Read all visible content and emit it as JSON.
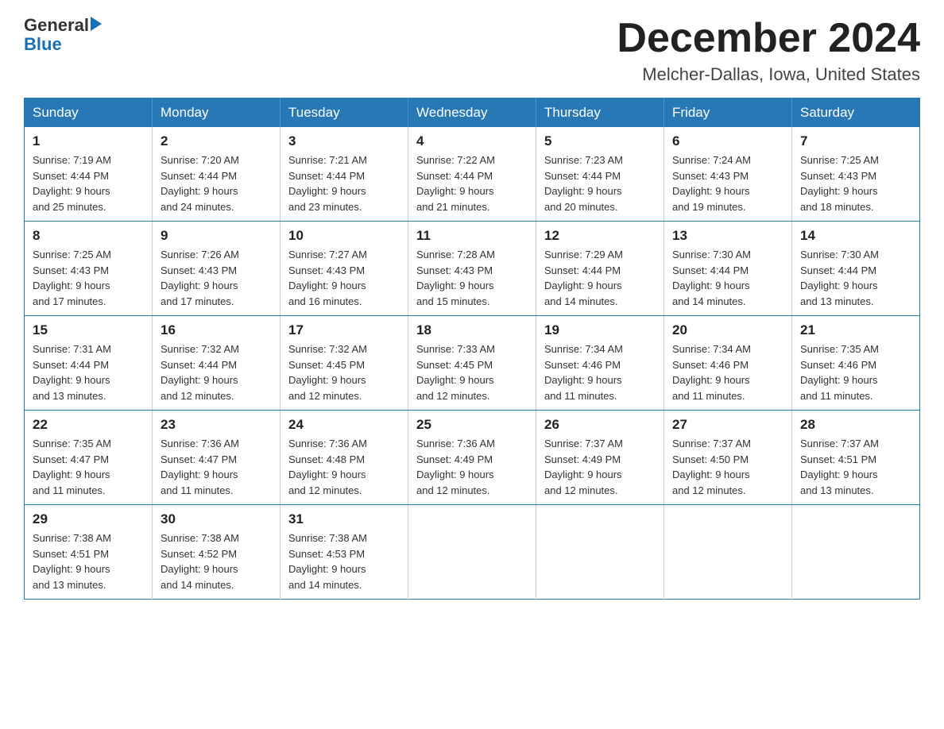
{
  "header": {
    "logo_general": "General",
    "logo_blue": "Blue",
    "month_title": "December 2024",
    "location": "Melcher-Dallas, Iowa, United States"
  },
  "weekdays": [
    "Sunday",
    "Monday",
    "Tuesday",
    "Wednesday",
    "Thursday",
    "Friday",
    "Saturday"
  ],
  "weeks": [
    [
      {
        "day": "1",
        "sunrise": "7:19 AM",
        "sunset": "4:44 PM",
        "daylight": "9 hours and 25 minutes."
      },
      {
        "day": "2",
        "sunrise": "7:20 AM",
        "sunset": "4:44 PM",
        "daylight": "9 hours and 24 minutes."
      },
      {
        "day": "3",
        "sunrise": "7:21 AM",
        "sunset": "4:44 PM",
        "daylight": "9 hours and 23 minutes."
      },
      {
        "day": "4",
        "sunrise": "7:22 AM",
        "sunset": "4:44 PM",
        "daylight": "9 hours and 21 minutes."
      },
      {
        "day": "5",
        "sunrise": "7:23 AM",
        "sunset": "4:44 PM",
        "daylight": "9 hours and 20 minutes."
      },
      {
        "day": "6",
        "sunrise": "7:24 AM",
        "sunset": "4:43 PM",
        "daylight": "9 hours and 19 minutes."
      },
      {
        "day": "7",
        "sunrise": "7:25 AM",
        "sunset": "4:43 PM",
        "daylight": "9 hours and 18 minutes."
      }
    ],
    [
      {
        "day": "8",
        "sunrise": "7:25 AM",
        "sunset": "4:43 PM",
        "daylight": "9 hours and 17 minutes."
      },
      {
        "day": "9",
        "sunrise": "7:26 AM",
        "sunset": "4:43 PM",
        "daylight": "9 hours and 17 minutes."
      },
      {
        "day": "10",
        "sunrise": "7:27 AM",
        "sunset": "4:43 PM",
        "daylight": "9 hours and 16 minutes."
      },
      {
        "day": "11",
        "sunrise": "7:28 AM",
        "sunset": "4:43 PM",
        "daylight": "9 hours and 15 minutes."
      },
      {
        "day": "12",
        "sunrise": "7:29 AM",
        "sunset": "4:44 PM",
        "daylight": "9 hours and 14 minutes."
      },
      {
        "day": "13",
        "sunrise": "7:30 AM",
        "sunset": "4:44 PM",
        "daylight": "9 hours and 14 minutes."
      },
      {
        "day": "14",
        "sunrise": "7:30 AM",
        "sunset": "4:44 PM",
        "daylight": "9 hours and 13 minutes."
      }
    ],
    [
      {
        "day": "15",
        "sunrise": "7:31 AM",
        "sunset": "4:44 PM",
        "daylight": "9 hours and 13 minutes."
      },
      {
        "day": "16",
        "sunrise": "7:32 AM",
        "sunset": "4:44 PM",
        "daylight": "9 hours and 12 minutes."
      },
      {
        "day": "17",
        "sunrise": "7:32 AM",
        "sunset": "4:45 PM",
        "daylight": "9 hours and 12 minutes."
      },
      {
        "day": "18",
        "sunrise": "7:33 AM",
        "sunset": "4:45 PM",
        "daylight": "9 hours and 12 minutes."
      },
      {
        "day": "19",
        "sunrise": "7:34 AM",
        "sunset": "4:46 PM",
        "daylight": "9 hours and 11 minutes."
      },
      {
        "day": "20",
        "sunrise": "7:34 AM",
        "sunset": "4:46 PM",
        "daylight": "9 hours and 11 minutes."
      },
      {
        "day": "21",
        "sunrise": "7:35 AM",
        "sunset": "4:46 PM",
        "daylight": "9 hours and 11 minutes."
      }
    ],
    [
      {
        "day": "22",
        "sunrise": "7:35 AM",
        "sunset": "4:47 PM",
        "daylight": "9 hours and 11 minutes."
      },
      {
        "day": "23",
        "sunrise": "7:36 AM",
        "sunset": "4:47 PM",
        "daylight": "9 hours and 11 minutes."
      },
      {
        "day": "24",
        "sunrise": "7:36 AM",
        "sunset": "4:48 PM",
        "daylight": "9 hours and 12 minutes."
      },
      {
        "day": "25",
        "sunrise": "7:36 AM",
        "sunset": "4:49 PM",
        "daylight": "9 hours and 12 minutes."
      },
      {
        "day": "26",
        "sunrise": "7:37 AM",
        "sunset": "4:49 PM",
        "daylight": "9 hours and 12 minutes."
      },
      {
        "day": "27",
        "sunrise": "7:37 AM",
        "sunset": "4:50 PM",
        "daylight": "9 hours and 12 minutes."
      },
      {
        "day": "28",
        "sunrise": "7:37 AM",
        "sunset": "4:51 PM",
        "daylight": "9 hours and 13 minutes."
      }
    ],
    [
      {
        "day": "29",
        "sunrise": "7:38 AM",
        "sunset": "4:51 PM",
        "daylight": "9 hours and 13 minutes."
      },
      {
        "day": "30",
        "sunrise": "7:38 AM",
        "sunset": "4:52 PM",
        "daylight": "9 hours and 14 minutes."
      },
      {
        "day": "31",
        "sunrise": "7:38 AM",
        "sunset": "4:53 PM",
        "daylight": "9 hours and 14 minutes."
      },
      null,
      null,
      null,
      null
    ]
  ],
  "labels": {
    "sunrise": "Sunrise:",
    "sunset": "Sunset:",
    "daylight": "Daylight:"
  }
}
